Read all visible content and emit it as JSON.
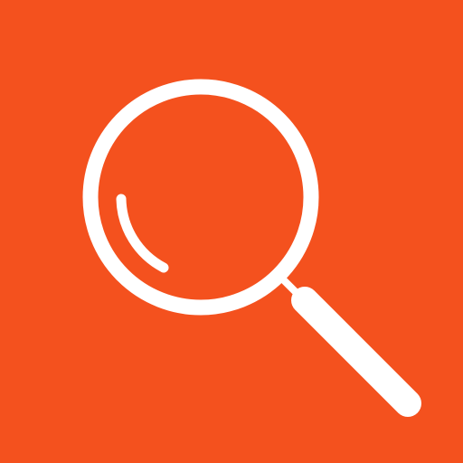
{
  "icon": {
    "name": "magnifying-glass-icon",
    "background_color": "#f4511e",
    "foreground_color": "#ffffff"
  }
}
